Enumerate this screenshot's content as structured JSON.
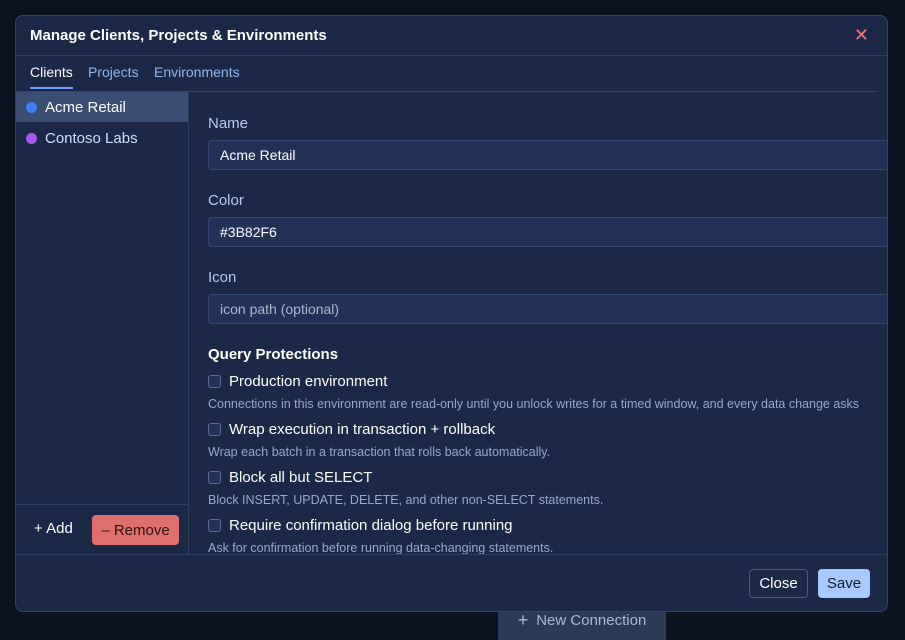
{
  "background": {
    "new_connection_label": "New Connection",
    "plus_icon": "+"
  },
  "dialog": {
    "title": "Manage Clients, Projects & Environments",
    "close_icon": "✕"
  },
  "tabs": [
    {
      "label": "Clients",
      "active": true
    },
    {
      "label": "Projects",
      "active": false
    },
    {
      "label": "Environments",
      "active": false
    }
  ],
  "clients": [
    {
      "name": "Acme Retail",
      "color": "#3B82F6",
      "selected": true
    },
    {
      "name": "Contoso Labs",
      "color": "#A855F7",
      "selected": false
    }
  ],
  "sidebar": {
    "add_label": "+ Add",
    "remove_label": "– Remove"
  },
  "form": {
    "name_label": "Name",
    "name_value": "Acme Retail",
    "color_label": "Color",
    "color_value": "#3B82F6",
    "icon_label": "Icon",
    "icon_placeholder": "icon path (optional)",
    "section_title": "Query Protections",
    "options": [
      {
        "label": "Production environment",
        "description": "Connections in this environment are read-only until you unlock writes for a timed window, and every data change asks",
        "checked": false
      },
      {
        "label": "Wrap execution in transaction + rollback",
        "description": "Wrap each batch in a transaction that rolls back automatically.",
        "checked": false
      },
      {
        "label": "Block all but SELECT",
        "description": "Block INSERT, UPDATE, DELETE, and other non-SELECT statements.",
        "checked": false
      },
      {
        "label": "Require confirmation dialog before running",
        "description": "Ask for confirmation before running data-changing statements.",
        "checked": false
      }
    ]
  },
  "footer": {
    "close_label": "Close",
    "save_label": "Save"
  }
}
